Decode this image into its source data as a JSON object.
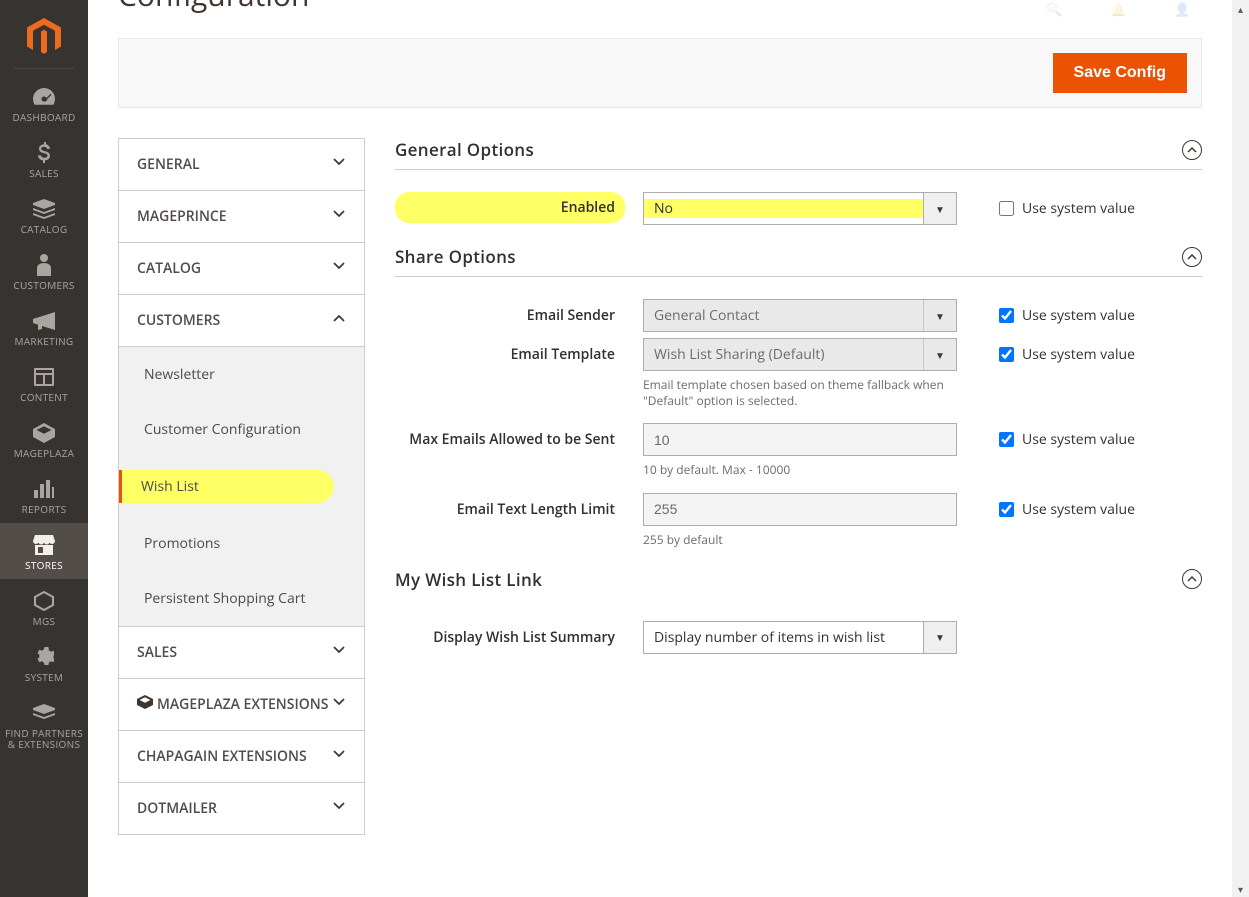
{
  "page_title": "Configuration",
  "save_button": "Save Config",
  "use_system_value": "Use system value",
  "menu": {
    "dashboard": "DASHBOARD",
    "sales": "SALES",
    "catalog": "CATALOG",
    "customers": "CUSTOMERS",
    "marketing": "MARKETING",
    "content": "CONTENT",
    "mageplaza": "MAGEPLAZA",
    "reports": "REPORTS",
    "stores": "STORES",
    "mgs": "MGS",
    "system": "SYSTEM",
    "find_partners": "FIND PARTNERS & EXTENSIONS"
  },
  "tabs": {
    "general": "GENERAL",
    "mageprince": "MAGEPRINCE",
    "catalog": "CATALOG",
    "customers": "CUSTOMERS",
    "sales": "SALES",
    "mageplaza_ext": "MAGEPLAZA EXTENSIONS",
    "chapagain": "CHAPAGAIN EXTENSIONS",
    "dotmailer": "DOTMAILER"
  },
  "subtabs": {
    "newsletter": "Newsletter",
    "customer_config": "Customer Configuration",
    "wish_list": "Wish List",
    "promotions": "Promotions",
    "persistent": "Persistent Shopping Cart"
  },
  "sections": {
    "general_options": "General Options",
    "share_options": "Share Options",
    "my_wish_list_link": "My Wish List Link"
  },
  "fields": {
    "enabled": {
      "label": "Enabled",
      "value": "No"
    },
    "email_sender": {
      "label": "Email Sender",
      "value": "General Contact"
    },
    "email_template": {
      "label": "Email Template",
      "value": "Wish List Sharing (Default)",
      "note": "Email template chosen based on theme fallback when \"Default\" option is selected."
    },
    "max_emails": {
      "label": "Max Emails Allowed to be Sent",
      "value": "10",
      "note": "10 by default. Max - 10000"
    },
    "text_limit": {
      "label": "Email Text Length Limit",
      "value": "255",
      "note": "255 by default"
    },
    "display_summary": {
      "label": "Display Wish List Summary",
      "value": "Display number of items in wish list"
    }
  }
}
